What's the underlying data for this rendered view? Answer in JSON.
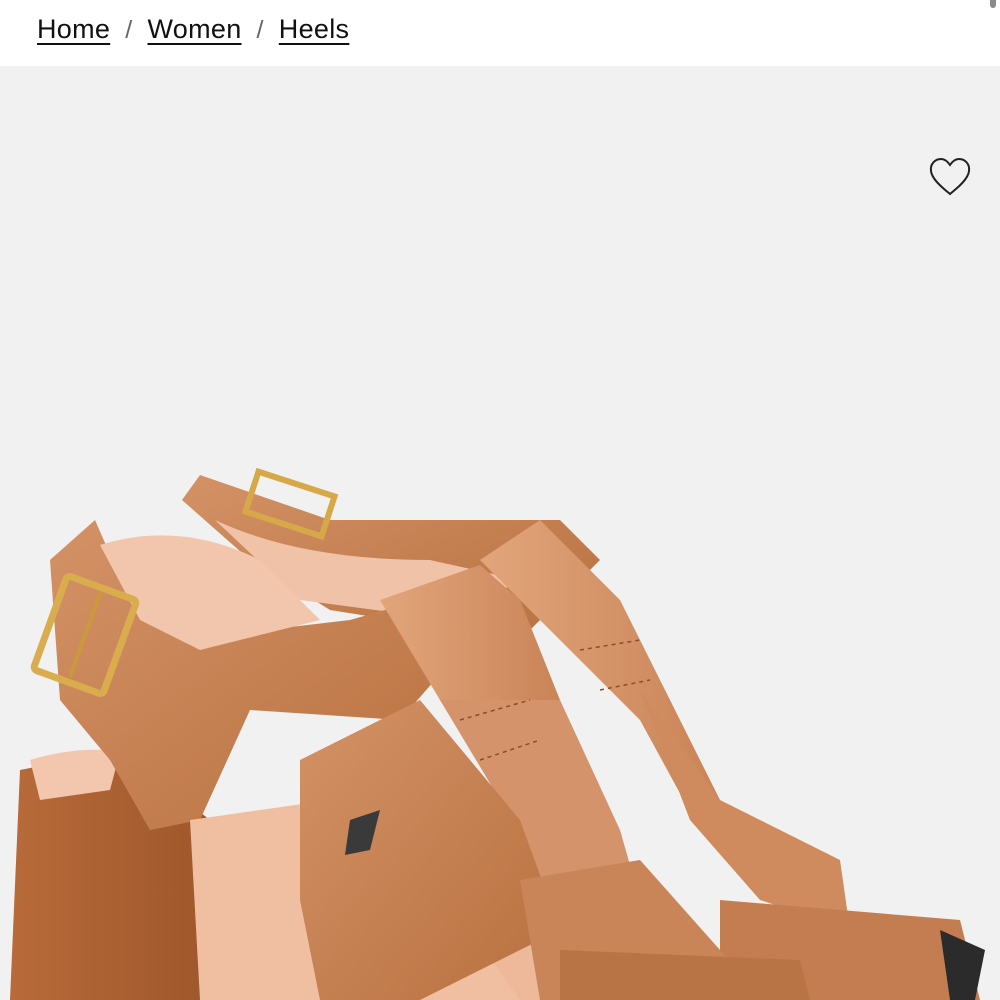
{
  "breadcrumb": {
    "items": [
      {
        "label": "Home"
      },
      {
        "label": "Women"
      },
      {
        "label": "Heels"
      }
    ],
    "separator": "/"
  },
  "product_image": {
    "subject": "tan leather fisherman block-heel sandals",
    "background_color": "#f1f1f1",
    "leather_color": "#c98457",
    "buckle_color": "#d6a848"
  },
  "wishlist": {
    "icon": "heart-outline-icon"
  }
}
